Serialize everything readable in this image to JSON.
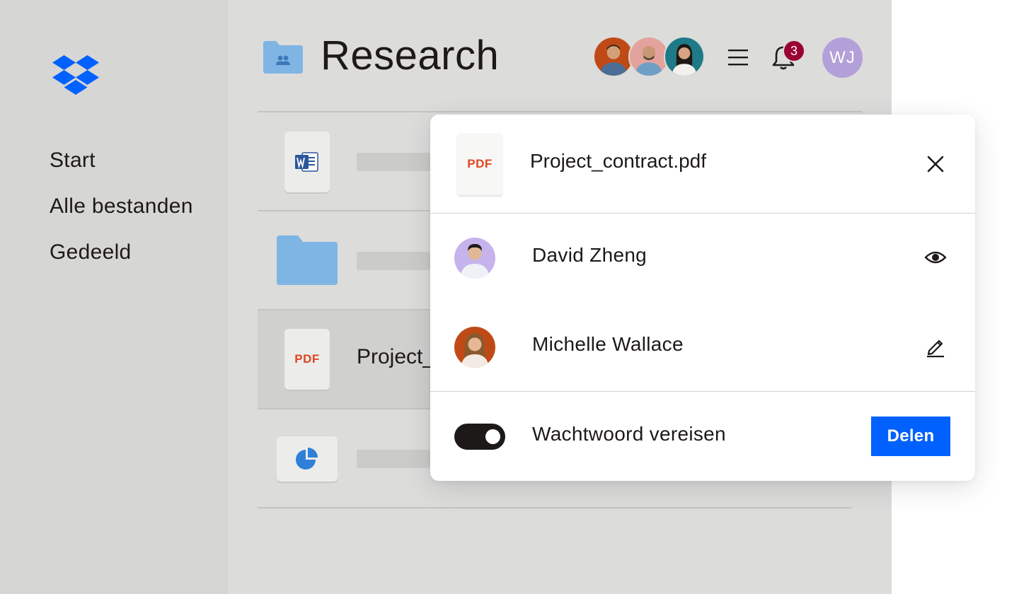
{
  "sidebar": {
    "logo_icon": "dropbox-logo-icon",
    "items": [
      {
        "label": "Start"
      },
      {
        "label": "Alle bestanden"
      },
      {
        "label": "Gedeeld"
      }
    ]
  },
  "header": {
    "folder_icon": "shared-folder-icon",
    "title": "Research",
    "menu_icon": "menu-icon",
    "bell_icon": "bell-icon",
    "notification_count": "3",
    "user_initials": "WJ"
  },
  "file_list": {
    "rows": [
      {
        "type": "word",
        "icon": "word-file-icon"
      },
      {
        "type": "folder",
        "icon": "folder-icon"
      },
      {
        "type": "pdf",
        "icon_label": "PDF",
        "name": "Project_contract.pdf"
      },
      {
        "type": "chart",
        "icon": "pie-chart-icon"
      }
    ]
  },
  "share_dialog": {
    "file_icon_label": "PDF",
    "file_name": "Project_contract.pdf",
    "close_icon": "close-icon",
    "people": [
      {
        "name": "David Zheng",
        "permission_icon": "eye-icon"
      },
      {
        "name": "Michelle Wallace",
        "permission_icon": "pencil-icon"
      }
    ],
    "password_toggle_label": "Wachtwoord vereisen",
    "password_toggle_on": true,
    "share_button_label": "Delen"
  },
  "colors": {
    "sidebar_bg": "#d6d6d5",
    "main_bg": "#dcdcdb",
    "brand_blue": "#0061fe",
    "folder_blue": "#7eb5e4",
    "pdf_red": "#e0451f",
    "badge": "#9b0032",
    "user_avatar": "#b4a0d8"
  }
}
